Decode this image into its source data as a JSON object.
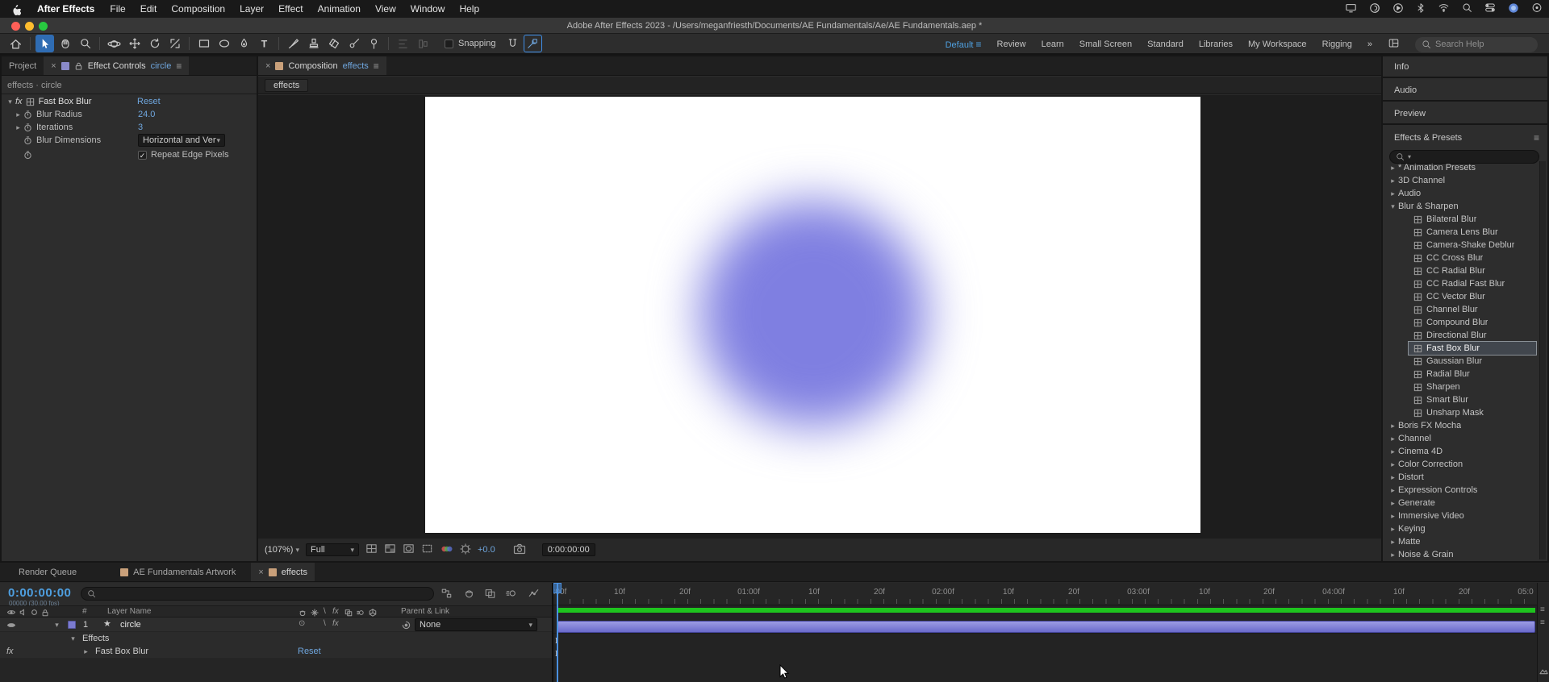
{
  "menubar": {
    "app_name": "After Effects",
    "menus": [
      "File",
      "Edit",
      "Composition",
      "Layer",
      "Effect",
      "Animation",
      "View",
      "Window",
      "Help"
    ]
  },
  "titlebar": {
    "title": "Adobe After Effects 2023 - /Users/meganfriesth/Documents/AE Fundamentals/Ae/AE Fundamentals.aep *"
  },
  "toolbar": {
    "snapping_label": "Snapping",
    "workspaces": [
      "Default",
      "Review",
      "Learn",
      "Small Screen",
      "Standard",
      "Libraries",
      "My Workspace",
      "Rigging"
    ],
    "overflow_chevrons": "»",
    "search_placeholder": "Search Help"
  },
  "effect_controls": {
    "project_tab": "Project",
    "panel_title": "Effect Controls",
    "panel_target": "circle",
    "breadcrumb": "effects · circle",
    "fx_badge": "fx",
    "effect_name": "Fast Box Blur",
    "reset_label": "Reset",
    "props": {
      "blur_radius": {
        "label": "Blur Radius",
        "value": "24.0"
      },
      "iterations": {
        "label": "Iterations",
        "value": "3"
      },
      "blur_dimensions": {
        "label": "Blur Dimensions",
        "value": "Horizontal and Vert"
      },
      "repeat_edge": {
        "label": "Repeat Edge Pixels"
      }
    }
  },
  "composition": {
    "tab_label": "Composition",
    "tab_target": "effects",
    "viewer_tab": "effects",
    "zoom": "(107%)",
    "resolution": "Full",
    "exposure": "+0.0",
    "timecode": "0:00:00:00"
  },
  "right_panel": {
    "info": "Info",
    "audio": "Audio",
    "preview": "Preview",
    "effects_presets": "Effects & Presets",
    "tree": [
      {
        "label": "* Animation Presets"
      },
      {
        "label": "3D Channel"
      },
      {
        "label": "Audio"
      },
      {
        "label": "Blur & Sharpen"
      },
      {
        "label": "Bilateral Blur"
      },
      {
        "label": "Camera Lens Blur"
      },
      {
        "label": "Camera-Shake Deblur"
      },
      {
        "label": "CC Cross Blur"
      },
      {
        "label": "CC Radial Blur"
      },
      {
        "label": "CC Radial Fast Blur"
      },
      {
        "label": "CC Vector Blur"
      },
      {
        "label": "Channel Blur"
      },
      {
        "label": "Compound Blur"
      },
      {
        "label": "Directional Blur"
      },
      {
        "label": "Fast Box Blur"
      },
      {
        "label": "Gaussian Blur"
      },
      {
        "label": "Radial Blur"
      },
      {
        "label": "Sharpen"
      },
      {
        "label": "Smart Blur"
      },
      {
        "label": "Unsharp Mask"
      },
      {
        "label": "Boris FX Mocha"
      },
      {
        "label": "Channel"
      },
      {
        "label": "Cinema 4D"
      },
      {
        "label": "Color Correction"
      },
      {
        "label": "Distort"
      },
      {
        "label": "Expression Controls"
      },
      {
        "label": "Generate"
      },
      {
        "label": "Immersive Video"
      },
      {
        "label": "Keying"
      },
      {
        "label": "Matte"
      },
      {
        "label": "Noise & Grain"
      }
    ]
  },
  "timeline": {
    "tab_render_queue": "Render Queue",
    "tab_artwork": "AE Fundamentals Artwork",
    "tab_effects": "effects",
    "timecode": "0:00:00:00",
    "frame_info": "00000 (30.00 fps)",
    "col_hash": "#",
    "col_layer_name": "Layer Name",
    "col_parent": "Parent & Link",
    "layer_index": "1",
    "layer_name": "circle",
    "parent_value": "None",
    "effects_group": "Effects",
    "effect_name": "Fast Box Blur",
    "reset_label": "Reset",
    "ruler": [
      ":00f",
      "10f",
      "20f",
      "01:00f",
      "10f",
      "20f",
      "02:00f",
      "10f",
      "20f",
      "03:00f",
      "10f",
      "20f",
      "04:00f",
      "10f",
      "20f",
      "05:0"
    ]
  }
}
